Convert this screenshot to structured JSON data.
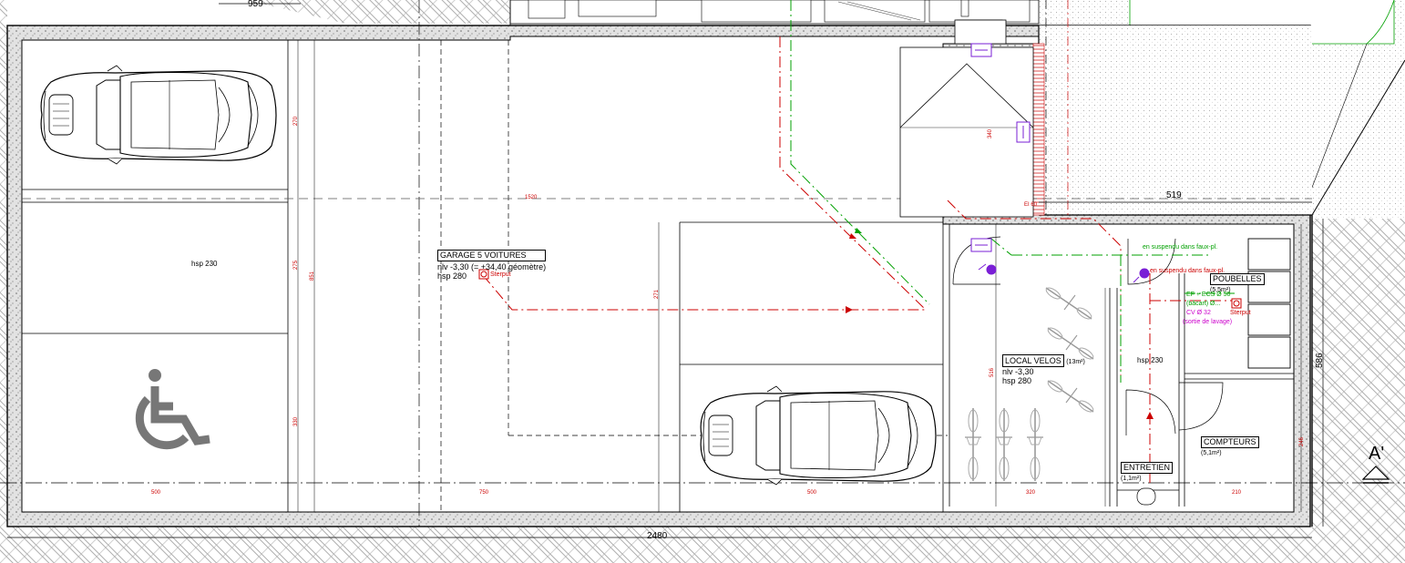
{
  "rooms": {
    "garage": {
      "name": "GARAGE 5 VOITURES",
      "level": "nlv  -3,30 (= +34,40 géomètre)",
      "height": "hsp 280",
      "sump": "Sterput"
    },
    "parking_height": "hsp 230",
    "bikes": {
      "name": "LOCAL VELOS",
      "area": "(13m²)",
      "level": "nlv  -3,30",
      "height": "hsp 280"
    },
    "bins": {
      "name": "POUBELLES",
      "area": "(5,5m²)",
      "sump": "Sterput"
    },
    "meters": {
      "name": "COMPTEURS",
      "area": "(5,1m²)"
    },
    "maintenance": {
      "name": "ENTRETIEN",
      "area": "(1,1m²)"
    },
    "corridor_height": "hsp 230"
  },
  "dimensions": {
    "top_left": "959",
    "right_width": "519",
    "right_height": "586",
    "overall_length": "2480",
    "d_1520": "1520",
    "d_500": "500",
    "d_750": "750",
    "d_500b": "500",
    "d_320": "320",
    "d_210": "210",
    "d_270": "270",
    "d_275": "275",
    "d_330": "330",
    "d_851": "851",
    "d_271": "271",
    "d_340": "340",
    "d_516": "516",
    "d_246": "246",
    "d_ei": "EI 60"
  },
  "notes": {
    "suspended_1": "en suspendu dans faux-pl.",
    "suspended_2": "en suspendu dans faux-pl.",
    "pipe_1": "EF + ECS Ø 50",
    "pipe_2": "(bâcart) Ø...",
    "pipe_3": "CV Ø 32",
    "pipe_4": "(sortie de lavage)"
  },
  "section_marker": "A'",
  "colors": {
    "wall_fill": "#e6e6e6",
    "ground_hatch": "#9a9a9a",
    "drain_red": "#cc0000",
    "water_green": "#00a000",
    "equipment_purple": "#7a1fd6",
    "pipe_magenta": "#cc00cc",
    "accessible_gray": "#777777"
  },
  "icons": [
    "car-icon",
    "wheelchair-icon",
    "bicycle-icon",
    "drain-sump-icon",
    "valve-icon"
  ]
}
